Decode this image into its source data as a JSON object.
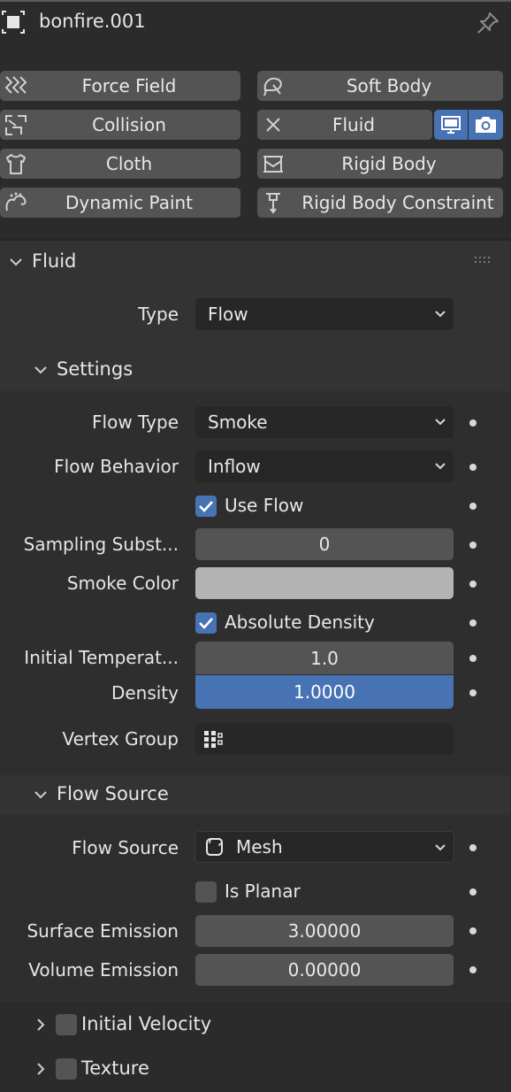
{
  "header": {
    "object_name": "bonfire.001"
  },
  "physics_buttons": [
    {
      "label": "Force Field",
      "icon": "force-field-icon"
    },
    {
      "label": "Soft Body",
      "icon": "soft-body-icon"
    },
    {
      "label": "Collision",
      "icon": "collision-icon"
    },
    {
      "label": "Fluid",
      "icon": "close-x-icon"
    },
    {
      "label": "Cloth",
      "icon": "cloth-icon"
    },
    {
      "label": "Rigid Body",
      "icon": "rigid-body-icon"
    },
    {
      "label": "Dynamic Paint",
      "icon": "dynamic-paint-icon"
    },
    {
      "label": "Rigid Body Constraint",
      "icon": "rigid-body-constraint-icon"
    }
  ],
  "colors": {
    "accent": "#4772b3",
    "panel": "#333333",
    "field": "#545454",
    "dropdown": "#272727",
    "smoke_color": "#b3b3b3"
  },
  "fluid_panel": {
    "title": "Fluid",
    "type_label": "Type",
    "type_value": "Flow",
    "settings": {
      "title": "Settings",
      "flow_type_label": "Flow Type",
      "flow_type_value": "Smoke",
      "flow_behavior_label": "Flow Behavior",
      "flow_behavior_value": "Inflow",
      "use_flow_label": "Use Flow",
      "use_flow_checked": true,
      "sampling_label": "Sampling Subst...",
      "sampling_value": "0",
      "smoke_color_label": "Smoke Color",
      "absolute_density_label": "Absolute Density",
      "absolute_density_checked": true,
      "initial_temp_label": "Initial Temperat...",
      "initial_temp_value": "1.0",
      "density_label": "Density",
      "density_value": "1.0000",
      "vertex_group_label": "Vertex Group",
      "vertex_group_value": ""
    },
    "flow_source": {
      "title": "Flow Source",
      "source_label": "Flow Source",
      "source_value": "Mesh",
      "is_planar_label": "Is Planar",
      "is_planar_checked": false,
      "surface_emission_label": "Surface Emission",
      "surface_emission_value": "3.00000",
      "volume_emission_label": "Volume Emission",
      "volume_emission_value": "0.00000"
    }
  },
  "collapsed_panels": [
    {
      "label": "Initial Velocity",
      "checked": false
    },
    {
      "label": "Texture",
      "checked": false
    }
  ]
}
